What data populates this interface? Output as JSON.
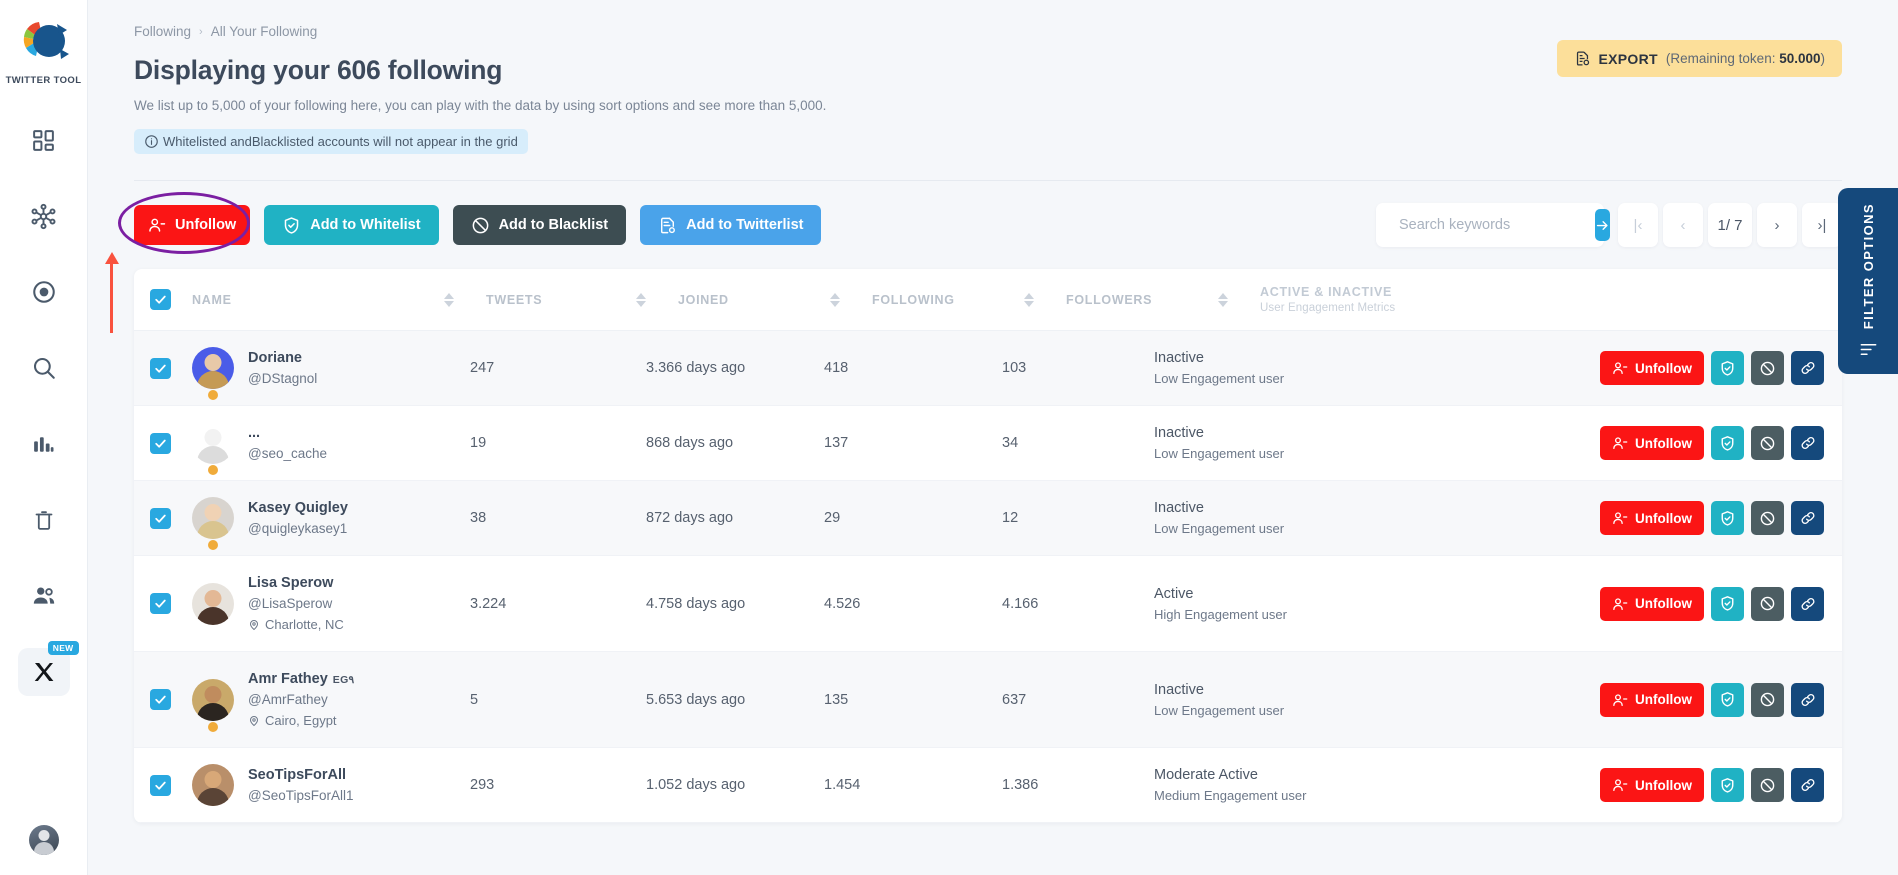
{
  "sidebar": {
    "brand_label": "TWITTER TOOL",
    "items": [
      {
        "icon": "dashboard-grid-icon",
        "name": "sidebar-item-dashboard"
      },
      {
        "icon": "network-nodes-icon",
        "name": "sidebar-item-network"
      },
      {
        "icon": "target-circle-icon",
        "name": "sidebar-item-target"
      },
      {
        "icon": "search-icon",
        "name": "sidebar-item-search"
      },
      {
        "icon": "bar-chart-icon",
        "name": "sidebar-item-analytics"
      },
      {
        "icon": "trash-icon",
        "name": "sidebar-item-cleanup"
      },
      {
        "icon": "users-icon",
        "name": "sidebar-item-following"
      },
      {
        "icon": "x-logo-icon",
        "name": "sidebar-item-x",
        "badge": "NEW"
      }
    ]
  },
  "breadcrumb": {
    "parent": "Following",
    "separator": "›",
    "current": "All Your Following"
  },
  "header": {
    "title": "Displaying your 606 following",
    "subtitle": "We list up to 5,000 of your following here, you can play with the data by using sort options and see more than 5,000.",
    "notice": "Whitelisted andBlacklisted accounts will not appear in the grid",
    "notice_icon": "info-circle-icon"
  },
  "export": {
    "icon": "export-file-icon",
    "label": "EXPORT",
    "suffix_pre": "(Remaining token: ",
    "token": "50.000",
    "suffix_post": ")"
  },
  "toolbar": {
    "unfollow_label": "Unfollow",
    "whitelist_label": "Add to Whitelist",
    "blacklist_label": "Add to Blacklist",
    "twitterlist_label": "Add to Twitterlist"
  },
  "search": {
    "placeholder": "Search keywords",
    "value": "",
    "go_icon": "arrow-right-icon"
  },
  "pagination": {
    "first": "|‹",
    "prev": "‹",
    "current": "1/ 7",
    "next": "›",
    "last": "›|"
  },
  "filter_tab": {
    "label": "FILTER OPTIONS",
    "icon": "filter-lines-icon"
  },
  "table": {
    "columns": {
      "name": "NAME",
      "tweets": "TWEETS",
      "joined": "JOINED",
      "following": "FOLLOWING",
      "followers": "FOLLOWERS",
      "engagement": "ACTIVE & INACTIVE",
      "engagement_sub": "User Engagement Metrics"
    },
    "row_actions": {
      "unfollow": "Unfollow",
      "whitelist_icon": "shield-check-icon",
      "blacklist_icon": "block-circle-icon",
      "link_icon": "link-chain-icon"
    },
    "rows": [
      {
        "checked": true,
        "name": "Doriane",
        "flag": "",
        "handle": "@DStagnol",
        "location": "",
        "tweets": "247",
        "joined": "3.366 days ago",
        "following": "418",
        "followers": "103",
        "status": "Inactive",
        "engagement": "Low Engagement user",
        "dot": true,
        "avatar_bg": "#4a5ce8",
        "avatar_skin": "#e8c9a8",
        "avatar_hair": "#c59a55"
      },
      {
        "checked": true,
        "name": "...",
        "flag": "",
        "handle": "@seo_cache",
        "location": "",
        "tweets": "19",
        "joined": "868 days ago",
        "following": "137",
        "followers": "34",
        "status": "Inactive",
        "engagement": "Low Engagement user",
        "dot": true,
        "avatar_bg": "#ffffff",
        "avatar_skin": "#f2f2f2",
        "avatar_hair": "#dcdcdc"
      },
      {
        "checked": true,
        "name": "Kasey Quigley",
        "flag": "",
        "handle": "@quigleykasey1",
        "location": "",
        "tweets": "38",
        "joined": "872 days ago",
        "following": "29",
        "followers": "12",
        "status": "Inactive",
        "engagement": "Low Engagement user",
        "dot": true,
        "avatar_bg": "#d8d4cf",
        "avatar_skin": "#f0d2b4",
        "avatar_hair": "#d9c48f"
      },
      {
        "checked": true,
        "name": "Lisa Sperow",
        "flag": "",
        "handle": "@LisaSperow",
        "location": "Charlotte, NC",
        "tweets": "3.224",
        "joined": "4.758 days ago",
        "following": "4.526",
        "followers": "4.166",
        "status": "Active",
        "engagement": "High Engagement user",
        "dot": false,
        "avatar_bg": "#e7e3dd",
        "avatar_skin": "#e3b895",
        "avatar_hair": "#4a342a"
      },
      {
        "checked": true,
        "name": "Amr Fathey",
        "flag": "EG۹",
        "handle": "@AmrFathey",
        "location": "Cairo, Egypt",
        "tweets": "5",
        "joined": "5.653 days ago",
        "following": "135",
        "followers": "637",
        "status": "Inactive",
        "engagement": "Low Engagement user",
        "dot": true,
        "avatar_bg": "#c9a96a",
        "avatar_skin": "#c08c5e",
        "avatar_hair": "#2b2520"
      },
      {
        "checked": true,
        "name": "SeoTipsForAll",
        "flag": "",
        "handle": "@SeoTipsForAll1",
        "location": "",
        "tweets": "293",
        "joined": "1.052 days ago",
        "following": "1.454",
        "followers": "1.386",
        "status": "Moderate Active",
        "engagement": "Medium Engagement user",
        "dot": false,
        "avatar_bg": "#b98f6a",
        "avatar_skin": "#d8a878",
        "avatar_hair": "#5a4436"
      }
    ]
  },
  "colors": {
    "accent": "#29a8e0",
    "danger": "#fb1515",
    "teal": "#20b2c4",
    "dark": "#3d4d52",
    "navy": "#15497c",
    "amber": "#fcdf9a",
    "highlight": "#7b1fa2",
    "arrow": "#f9523e"
  }
}
